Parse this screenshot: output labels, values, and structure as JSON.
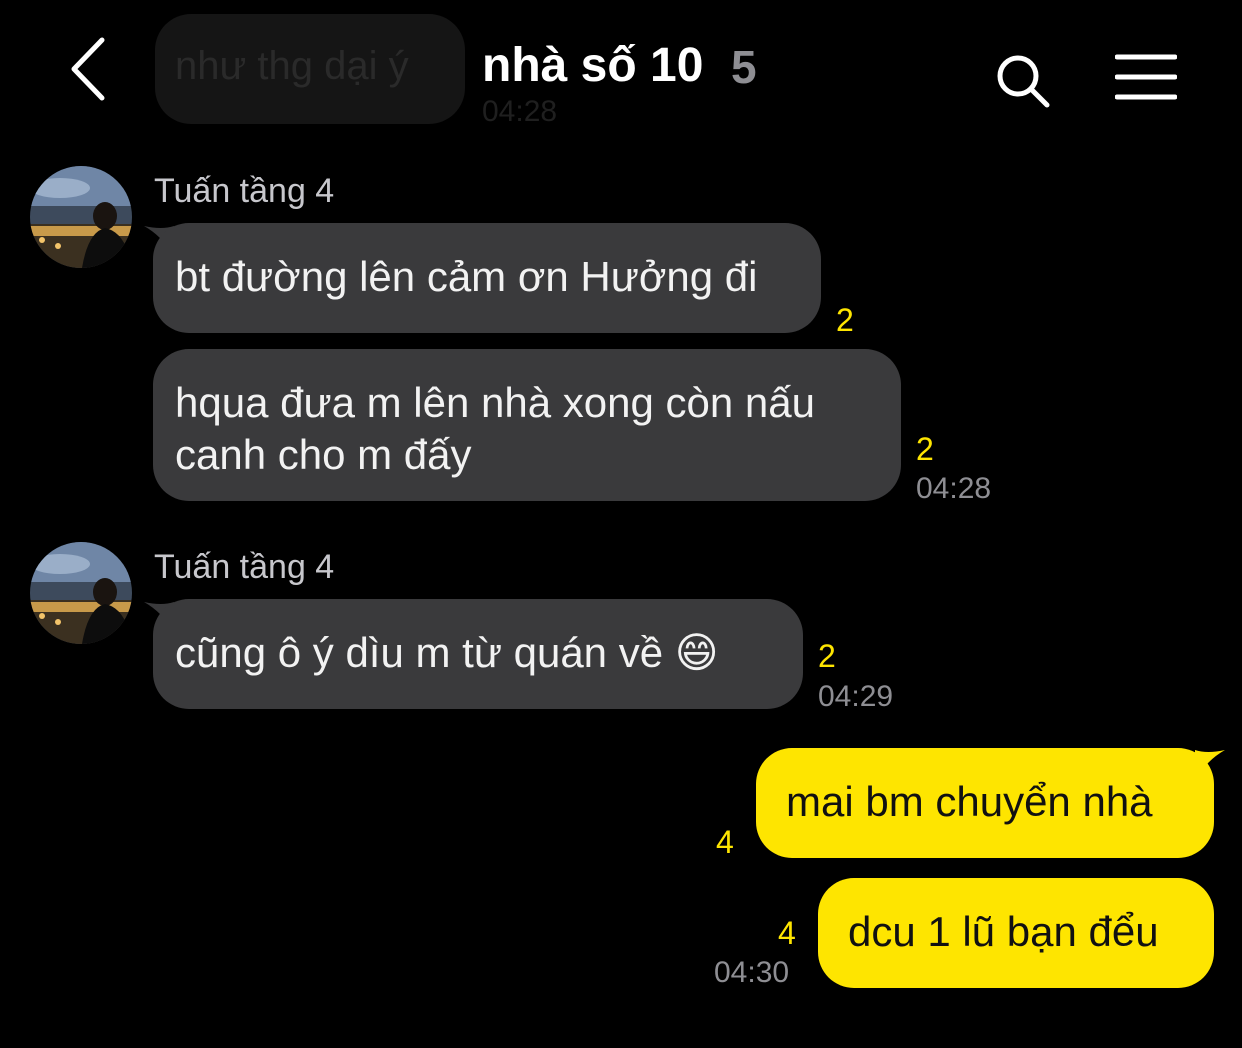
{
  "header": {
    "title": "nhà số 10",
    "member_count": "5",
    "ghost_message": "như thg dại ý",
    "ghost_time": "04:28"
  },
  "icons": {
    "back": "chevron-left-icon",
    "search": "search-icon",
    "menu": "hamburger-menu-icon"
  },
  "colors": {
    "background": "#000000",
    "incoming_bubble": "#3a3a3c",
    "outgoing_bubble": "#fee500",
    "unread": "#fee500",
    "timestamp": "#8e8e93"
  },
  "messages": [
    {
      "sender": "Tuấn tầng 4",
      "text": "bt đường lên cảm ơn Hưởng đi",
      "unread": "2"
    },
    {
      "text_line1": "hqua đưa m lên nhà xong còn nấu",
      "text_line2": "canh cho m đấy",
      "unread": "2",
      "time": "04:28"
    },
    {
      "sender": "Tuấn tầng 4",
      "text": "cũng ô ý dìu m từ quán về 😄",
      "unread": "2",
      "time": "04:29"
    },
    {
      "text": "mai bm chuyển nhà",
      "unread": "4"
    },
    {
      "text": "dcu 1 lũ bạn đểu",
      "unread": "4",
      "time": "04:30"
    }
  ]
}
